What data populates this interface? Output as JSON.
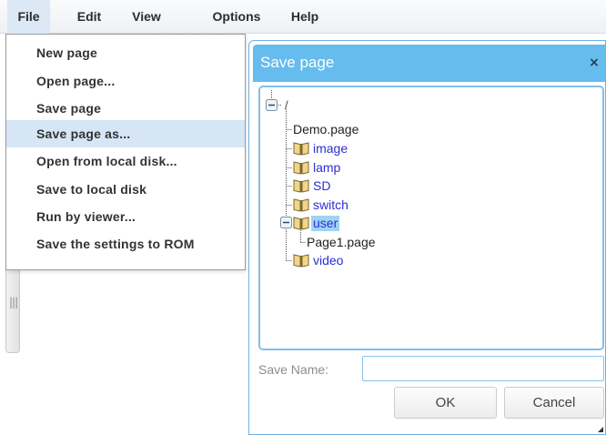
{
  "menubar": {
    "items": [
      {
        "label": "File"
      },
      {
        "label": "Edit"
      },
      {
        "label": "View"
      },
      {
        "label": "Options"
      },
      {
        "label": "Help"
      }
    ],
    "active": "File"
  },
  "file_menu": {
    "items": [
      {
        "label": "New page"
      },
      {
        "label": "Open page..."
      },
      {
        "label": "Save page"
      },
      {
        "label": "Save page as..."
      },
      {
        "label": "Open from local disk..."
      },
      {
        "label": "Save to local disk"
      },
      {
        "label": "Run by viewer..."
      },
      {
        "label": "Save the settings to ROM"
      }
    ],
    "highlighted": "Save page as..."
  },
  "dialog": {
    "title": "Save page",
    "close_label": "×",
    "tree": {
      "root": "/",
      "nodes": [
        {
          "label": "Demo.page",
          "kind": "file"
        },
        {
          "label": "image",
          "kind": "folder"
        },
        {
          "label": "lamp",
          "kind": "folder"
        },
        {
          "label": "SD",
          "kind": "folder"
        },
        {
          "label": "switch",
          "kind": "folder"
        },
        {
          "label": "user",
          "kind": "folder",
          "expanded": true,
          "selected": true
        },
        {
          "label": "Page1.page",
          "kind": "file",
          "parent": "user"
        },
        {
          "label": "video",
          "kind": "folder"
        }
      ]
    },
    "save_name_label": "Save Name:",
    "save_name_value": "",
    "ok_label": "OK",
    "cancel_label": "Cancel"
  },
  "colors": {
    "title_bar": "#66bcec",
    "highlight": "#d6e6f5",
    "folder_text": "#2e2ed6",
    "selected": "#9fd3f3"
  },
  "icons": {
    "folder": "book-folder-icon",
    "collapse": "minus-box-icon",
    "close": "close-icon",
    "grip": "grip-icon"
  }
}
